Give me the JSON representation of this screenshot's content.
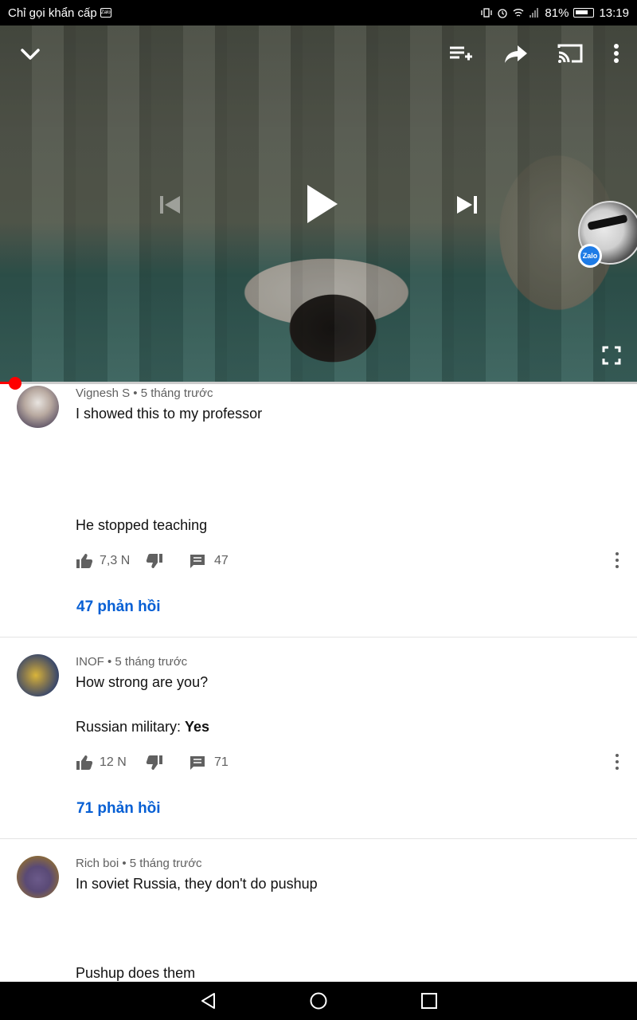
{
  "status_bar": {
    "emergency_text": "Chỉ gọi khẩn cấp",
    "zalo_label": "Zalo",
    "battery": "81%",
    "time": "13:19"
  },
  "video": {
    "progress_fraction": 0.02,
    "bubble_app": "Zalo",
    "icons": [
      "chevron-down-icon",
      "add-to-queue-icon",
      "share-icon",
      "cast-icon",
      "more-vert-icon",
      "skip-previous-icon",
      "play-icon",
      "skip-next-icon",
      "fullscreen-icon"
    ]
  },
  "comments": [
    {
      "author_meta": "Vignesh S • 5 tháng trước",
      "line1": "I showed this to my professor",
      "line2": "He stopped teaching",
      "likes": "7,3 N",
      "reply_count": "47",
      "replies_link": "47 phản hồi"
    },
    {
      "author_meta": "INOF • 5 tháng trước",
      "line1": "How strong are you?",
      "line2_prefix": "Russian military: ",
      "line2_bold": "Yes",
      "likes": "12 N",
      "reply_count": "71",
      "replies_link": "71 phản hồi"
    },
    {
      "author_meta": "Rich boi • 5 tháng trước",
      "line1": "In soviet Russia, they don't do pushup",
      "line2": "Pushup does them"
    }
  ],
  "colors": {
    "link": "#065fd4",
    "progress": "#ff0000",
    "meta_text": "#606060"
  }
}
